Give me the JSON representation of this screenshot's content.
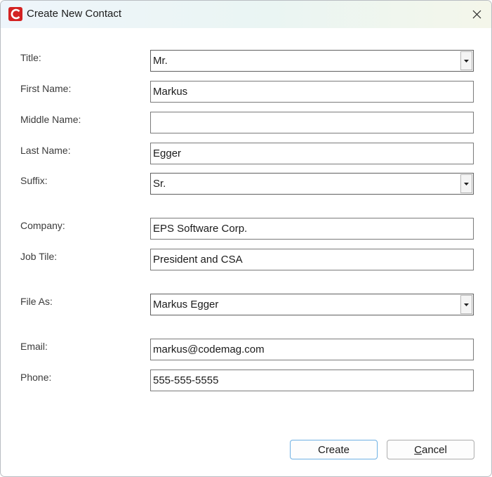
{
  "window": {
    "title": "Create New Contact"
  },
  "icons": {
    "app": "app-logo-icon",
    "close": "close-icon",
    "dropdown": "chevron-down-icon"
  },
  "colors": {
    "app_icon": "#d32222",
    "accent_border": "#6fb1e3"
  },
  "form": {
    "title": {
      "label": "Title:",
      "value": "Mr."
    },
    "first_name": {
      "label": "First Name:",
      "value": "Markus"
    },
    "middle_name": {
      "label": "Middle Name:",
      "value": ""
    },
    "last_name": {
      "label": "Last Name:",
      "value": "Egger"
    },
    "suffix": {
      "label": "Suffix:",
      "value": "Sr."
    },
    "company": {
      "label": "Company:",
      "value": "EPS Software Corp."
    },
    "job_title": {
      "label": "Job Tile:",
      "value": "President and CSA"
    },
    "file_as": {
      "label": "File As:",
      "value": "Markus Egger"
    },
    "email": {
      "label": "Email:",
      "value": "markus@codemag.com"
    },
    "phone": {
      "label": "Phone:",
      "value": "555-555-5555"
    }
  },
  "buttons": {
    "create": "Create",
    "cancel_first": "C",
    "cancel_rest": "ancel"
  }
}
